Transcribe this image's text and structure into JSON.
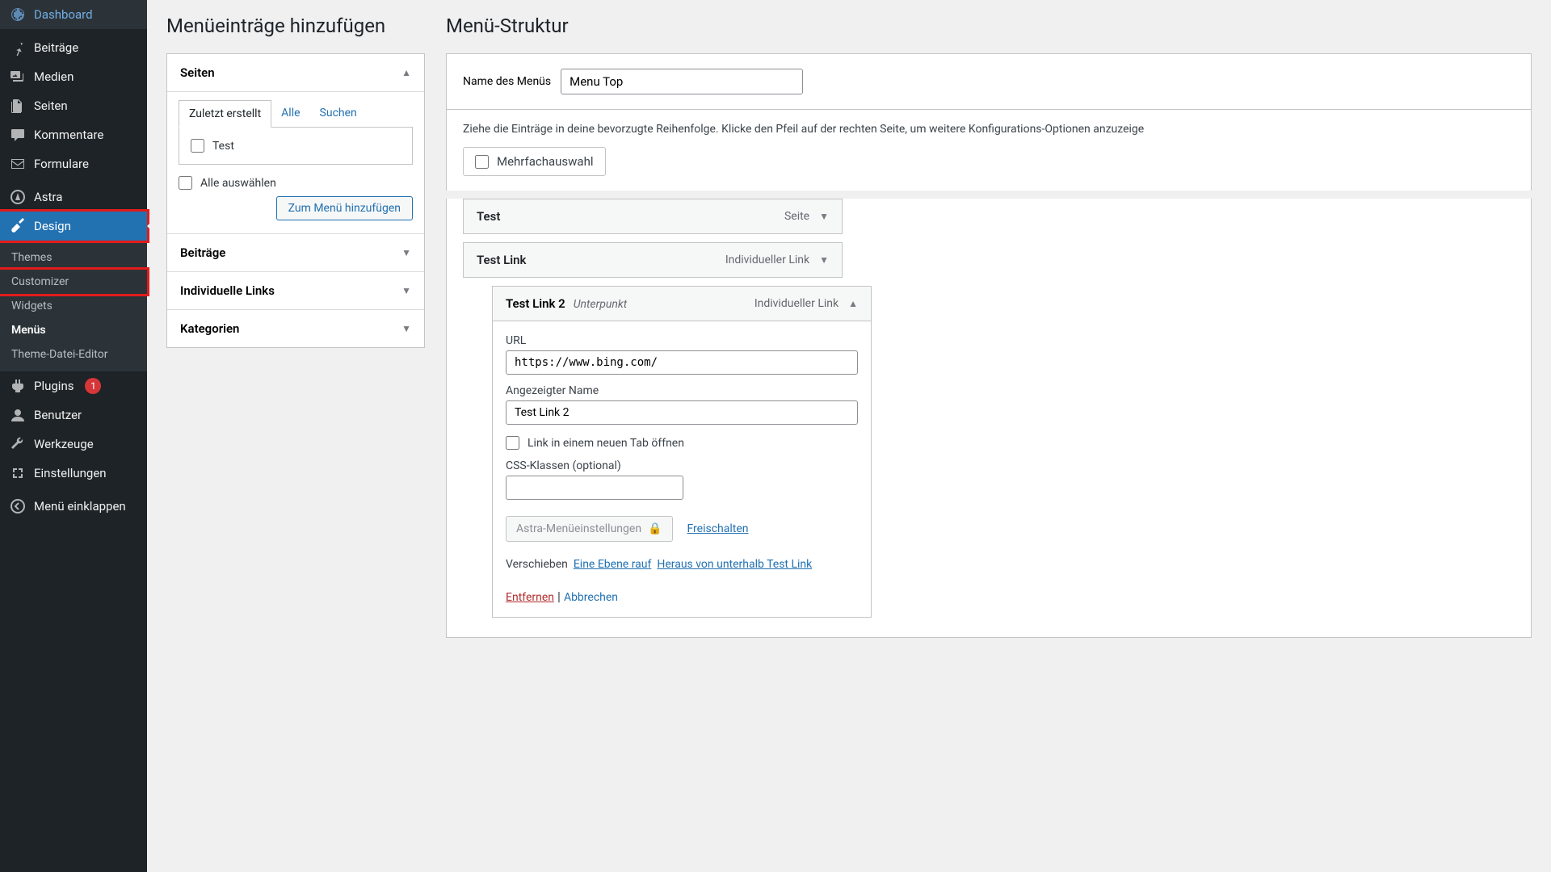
{
  "sidebar": {
    "items": [
      {
        "label": "Dashboard"
      },
      {
        "label": "Beiträge"
      },
      {
        "label": "Medien"
      },
      {
        "label": "Seiten"
      },
      {
        "label": "Kommentare"
      },
      {
        "label": "Formulare"
      },
      {
        "label": "Astra"
      },
      {
        "label": "Design"
      },
      {
        "label": "Plugins",
        "badge": "1"
      },
      {
        "label": "Benutzer"
      },
      {
        "label": "Werkzeuge"
      },
      {
        "label": "Einstellungen"
      },
      {
        "label": "Menü einklappen"
      }
    ],
    "submenu": [
      {
        "label": "Themes"
      },
      {
        "label": "Customizer"
      },
      {
        "label": "Widgets"
      },
      {
        "label": "Menüs"
      },
      {
        "label": "Theme-Datei-Editor"
      }
    ]
  },
  "left": {
    "heading": "Menüeinträge hinzufügen",
    "acc_pages": "Seiten",
    "tabs": {
      "recent": "Zuletzt erstellt",
      "all": "Alle",
      "search": "Suchen"
    },
    "page_test": "Test",
    "select_all": "Alle auswählen",
    "add_btn": "Zum Menü hinzufügen",
    "acc_posts": "Beiträge",
    "acc_links": "Individuelle Links",
    "acc_cats": "Kategorien"
  },
  "right": {
    "heading": "Menü-Struktur",
    "name_label": "Name des Menüs",
    "name_value": "Menu Top",
    "instructions": "Ziehe die Einträge in deine bevorzugte Reihenfolge. Klicke den Pfeil auf der rechten Seite, um weitere Konfigurations-Optionen anzuzeige",
    "bulk": "Mehrfachauswahl",
    "items": {
      "i1": {
        "title": "Test",
        "type": "Seite"
      },
      "i2": {
        "title": "Test Link",
        "type": "Individueller Link"
      },
      "i3": {
        "title": "Test Link 2",
        "sub": "Unterpunkt",
        "type": "Individueller Link",
        "url_label": "URL",
        "url_value": "https://www.bing.com/",
        "name_label": "Angezeigter Name",
        "name_value": "Test Link 2",
        "newtab": "Link in einem neuen Tab öffnen",
        "css_label": "CSS-Klassen (optional)",
        "astra": "Astra-Menüeinstellungen",
        "unlock": "Freischalten",
        "move_label": "Verschieben",
        "move_up": "Eine Ebene rauf",
        "move_out": "Heraus von unterhalb Test Link",
        "remove": "Entfernen",
        "cancel": "Abbrechen"
      }
    }
  }
}
